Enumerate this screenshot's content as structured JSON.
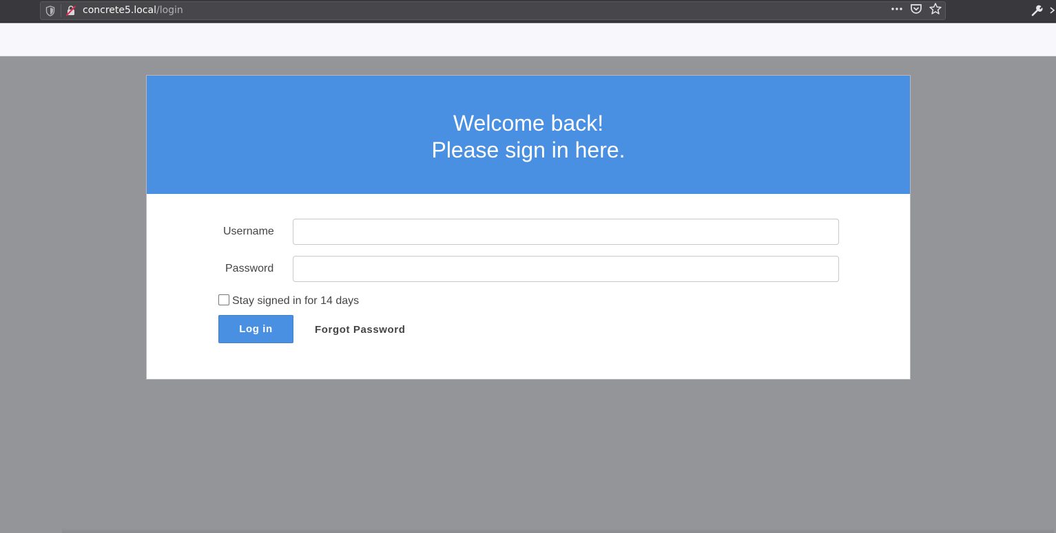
{
  "browser": {
    "url_host": "concrete5.local",
    "url_path": "/login",
    "icons": {
      "tracking_protection": "shield-icon",
      "insecure": "insecure-lock-icon",
      "page_actions": "more-dots-icon",
      "pocket": "pocket-icon",
      "bookmark": "star-icon",
      "developer": "wrench-icon"
    }
  },
  "login": {
    "heading_line1": "Welcome back!",
    "heading_line2": "Please sign in here.",
    "username_label": "Username",
    "username_value": "",
    "password_label": "Password",
    "password_value": "",
    "remember_label": "Stay signed in for 14 days",
    "remember_checked": false,
    "login_button": "Log in",
    "forgot_link": "Forgot Password"
  },
  "colors": {
    "accent": "#4a90e2",
    "page_background": "#949599",
    "browser_toolbar": "#38383d"
  }
}
